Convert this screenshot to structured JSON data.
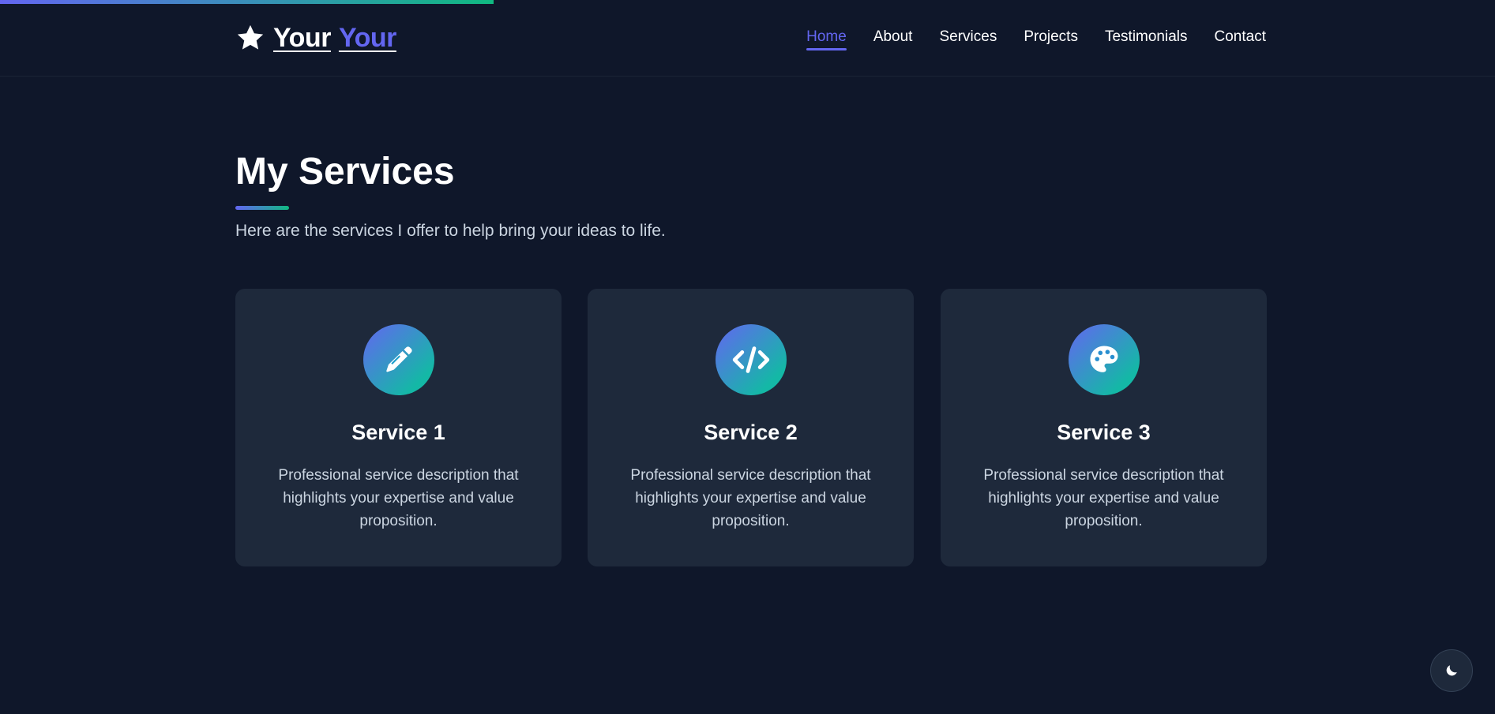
{
  "header": {
    "logo_word1": "Your",
    "logo_word2": "Your",
    "logo_icon": "star-icon",
    "nav": [
      {
        "label": "Home",
        "active": true
      },
      {
        "label": "About"
      },
      {
        "label": "Services"
      },
      {
        "label": "Projects"
      },
      {
        "label": "Testimonials"
      },
      {
        "label": "Contact"
      }
    ]
  },
  "scroll_progress": 0.33,
  "services": {
    "title": "My Services",
    "subtitle": "Here are the services I offer to help bring your ideas to life.",
    "cards": [
      {
        "icon": "pencil-icon",
        "title": "Service 1",
        "description": "Professional service description that highlights your expertise and value proposition."
      },
      {
        "icon": "code-icon",
        "title": "Service 2",
        "description": "Professional service description that highlights your expertise and value proposition."
      },
      {
        "icon": "palette-icon",
        "title": "Service 3",
        "description": "Professional service description that highlights your expertise and value proposition."
      }
    ]
  },
  "theme_toggle": {
    "icon": "moon-icon"
  },
  "colors": {
    "background": "#0f172a",
    "card": "#1e293b",
    "accent": "#6366f1",
    "accent_secondary": "#14b8a6"
  }
}
